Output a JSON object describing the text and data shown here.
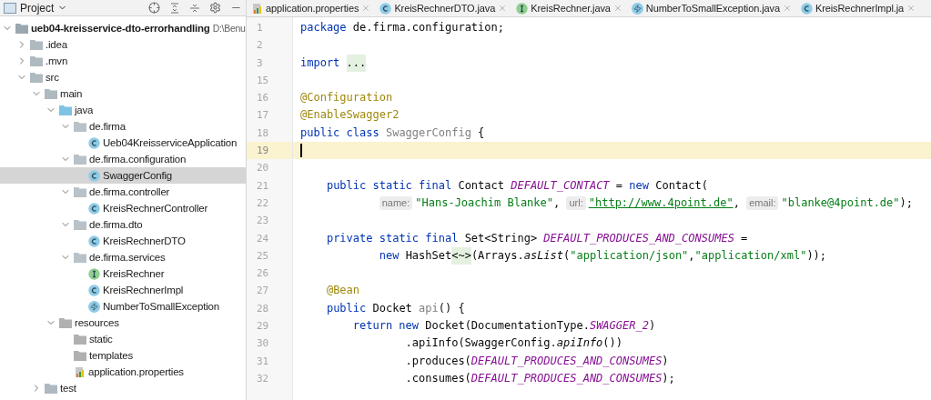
{
  "project_panel": {
    "title": "Project",
    "tree": [
      {
        "kind": "module",
        "label": "ueb04-kreisservice-dto-errorhandling",
        "path": "D:\\Benu",
        "expanded": true,
        "selected": false,
        "children": [
          {
            "kind": "folder",
            "label": ".idea",
            "expanded": false,
            "selected": false
          },
          {
            "kind": "folder",
            "label": ".mvn",
            "expanded": false,
            "selected": false
          },
          {
            "kind": "folder",
            "label": "src",
            "expanded": true,
            "selected": false,
            "children": [
              {
                "kind": "folder",
                "label": "main",
                "expanded": true,
                "selected": false,
                "children": [
                  {
                    "kind": "source",
                    "label": "java",
                    "expanded": true,
                    "selected": false,
                    "children": [
                      {
                        "kind": "package",
                        "label": "de.firma",
                        "expanded": true,
                        "selected": false,
                        "children": [
                          {
                            "kind": "app",
                            "label": "Ueb04KreisserviceApplication",
                            "selected": false
                          }
                        ]
                      },
                      {
                        "kind": "package",
                        "label": "de.firma.configuration",
                        "expanded": true,
                        "selected": false,
                        "children": [
                          {
                            "kind": "class",
                            "label": "SwaggerConfig",
                            "selected": true
                          }
                        ]
                      },
                      {
                        "kind": "package",
                        "label": "de.firma.controller",
                        "expanded": true,
                        "selected": false,
                        "children": [
                          {
                            "kind": "class",
                            "label": "KreisRechnerController",
                            "selected": false
                          }
                        ]
                      },
                      {
                        "kind": "package",
                        "label": "de.firma.dto",
                        "expanded": true,
                        "selected": false,
                        "children": [
                          {
                            "kind": "class",
                            "label": "KreisRechnerDTO",
                            "selected": false
                          }
                        ]
                      },
                      {
                        "kind": "package",
                        "label": "de.firma.services",
                        "expanded": true,
                        "selected": false,
                        "children": [
                          {
                            "kind": "interface",
                            "label": "KreisRechner",
                            "selected": false
                          },
                          {
                            "kind": "class",
                            "label": "KreisRechnerImpl",
                            "selected": false
                          },
                          {
                            "kind": "exception",
                            "label": "NumberToSmallException",
                            "selected": false
                          }
                        ]
                      }
                    ]
                  },
                  {
                    "kind": "resources",
                    "label": "resources",
                    "expanded": true,
                    "selected": false,
                    "children": [
                      {
                        "kind": "plain",
                        "label": "static",
                        "selected": false
                      },
                      {
                        "kind": "plain",
                        "label": "templates",
                        "selected": false
                      },
                      {
                        "kind": "properties",
                        "label": "application.properties",
                        "selected": false
                      }
                    ]
                  }
                ]
              },
              {
                "kind": "folder",
                "label": "test",
                "expanded": false,
                "selected": false
              }
            ]
          }
        ]
      }
    ]
  },
  "editor_tabs": [
    {
      "kind": "properties",
      "label": "application.properties"
    },
    {
      "kind": "class",
      "label": "KreisRechnerDTO.java"
    },
    {
      "kind": "interface",
      "label": "KreisRechner.java"
    },
    {
      "kind": "exception",
      "label": "NumberToSmallException.java"
    },
    {
      "kind": "class",
      "label": "KreisRechnerImpl.ja"
    }
  ],
  "code": [
    {
      "number": "1",
      "current": false,
      "tokens": [
        {
          "kind": "kw",
          "text": "package"
        },
        {
          "kind": "plain",
          "text": " de.firma.configuration;"
        }
      ]
    },
    {
      "number": "2",
      "current": false
    },
    {
      "number": "3",
      "current": false,
      "tokens": [
        {
          "kind": "kw",
          "text": "import"
        },
        {
          "kind": "folded",
          "text": " ..."
        }
      ]
    },
    {
      "number": "15",
      "current": false
    },
    {
      "number": "16",
      "current": false,
      "tokens": [
        {
          "kind": "ann",
          "text": "@Configuration"
        }
      ]
    },
    {
      "number": "17",
      "current": false,
      "tokens": [
        {
          "kind": "ann",
          "text": "@EnableSwagger2"
        }
      ]
    },
    {
      "number": "18",
      "current": false,
      "tokens": [
        {
          "kind": "kw",
          "text": "public class"
        },
        {
          "kind": "unused",
          "text": " SwaggerConfig"
        },
        {
          "kind": "plain",
          "text": " {"
        }
      ]
    },
    {
      "number": "19",
      "current": true
    },
    {
      "number": "20",
      "current": false
    },
    {
      "number": "21",
      "current": false,
      "tokens": [
        {
          "kind": "kw",
          "text": "    public static final"
        },
        {
          "kind": "plain",
          "text": " Contact "
        },
        {
          "kind": "const",
          "text": "DEFAULT_CONTACT"
        },
        {
          "kind": "plain",
          "text": " = "
        },
        {
          "kind": "kw",
          "text": "new"
        },
        {
          "kind": "plain",
          "text": " Contact("
        }
      ]
    },
    {
      "number": "22",
      "current": false,
      "tokens": [
        {
          "kind": "hint",
          "text": "            name:"
        },
        {
          "kind": "str",
          "text": "\"Hans-Joachim Blanke\""
        },
        {
          "kind": "plain",
          "text": ", "
        },
        {
          "kind": "hint",
          "text": "url:"
        },
        {
          "kind": "link",
          "text": "\"http://www.4point.de\""
        },
        {
          "kind": "plain",
          "text": ", "
        },
        {
          "kind": "hint",
          "text": "email:"
        },
        {
          "kind": "str",
          "text": "\"blanke@4point.de\""
        },
        {
          "kind": "plain",
          "text": ");"
        }
      ]
    },
    {
      "number": "23",
      "current": false
    },
    {
      "number": "24",
      "current": false,
      "tokens": [
        {
          "kind": "kw",
          "text": "    private static final"
        },
        {
          "kind": "plain",
          "text": " Set<String> "
        },
        {
          "kind": "const",
          "text": "DEFAULT_PRODUCES_AND_CONSUMES"
        },
        {
          "kind": "plain",
          "text": " ="
        }
      ]
    },
    {
      "number": "25",
      "current": false,
      "tokens": [
        {
          "kind": "kw",
          "text": "            new"
        },
        {
          "kind": "plain",
          "text": " HashSet"
        },
        {
          "kind": "folded",
          "text": "<~>"
        },
        {
          "kind": "plain",
          "text": "(Arrays."
        },
        {
          "kind": "method",
          "text": "asList"
        },
        {
          "kind": "plain",
          "text": "("
        },
        {
          "kind": "str",
          "text": "\"application/json\""
        },
        {
          "kind": "plain",
          "text": ","
        },
        {
          "kind": "str",
          "text": "\"application/xml\""
        },
        {
          "kind": "plain",
          "text": "));"
        }
      ]
    },
    {
      "number": "26",
      "current": false
    },
    {
      "number": "27",
      "current": false,
      "tokens": [
        {
          "kind": "ann",
          "text": "    @Bean"
        }
      ]
    },
    {
      "number": "28",
      "current": false,
      "tokens": [
        {
          "kind": "kw",
          "text": "    public"
        },
        {
          "kind": "plain",
          "text": " Docket "
        },
        {
          "kind": "unused",
          "text": "api"
        },
        {
          "kind": "plain",
          "text": "() {"
        }
      ]
    },
    {
      "number": "29",
      "current": false,
      "tokens": [
        {
          "kind": "kw",
          "text": "        return new"
        },
        {
          "kind": "plain",
          "text": " Docket(DocumentationType."
        },
        {
          "kind": "const",
          "text": "SWAGGER_2"
        },
        {
          "kind": "plain",
          "text": ")"
        }
      ]
    },
    {
      "number": "30",
      "current": false,
      "tokens": [
        {
          "kind": "plain",
          "text": "                .apiInfo(SwaggerConfig."
        },
        {
          "kind": "method",
          "text": "apiInfo"
        },
        {
          "kind": "plain",
          "text": "())"
        }
      ]
    },
    {
      "number": "31",
      "current": false,
      "tokens": [
        {
          "kind": "plain",
          "text": "                .produces("
        },
        {
          "kind": "const",
          "text": "DEFAULT_PRODUCES_AND_CONSUMES"
        },
        {
          "kind": "plain",
          "text": ")"
        }
      ]
    },
    {
      "number": "32",
      "current": false,
      "tokens": [
        {
          "kind": "plain",
          "text": "                .consumes("
        },
        {
          "kind": "const",
          "text": "DEFAULT_PRODUCES_AND_CONSUMES"
        },
        {
          "kind": "plain",
          "text": ");"
        }
      ]
    }
  ]
}
